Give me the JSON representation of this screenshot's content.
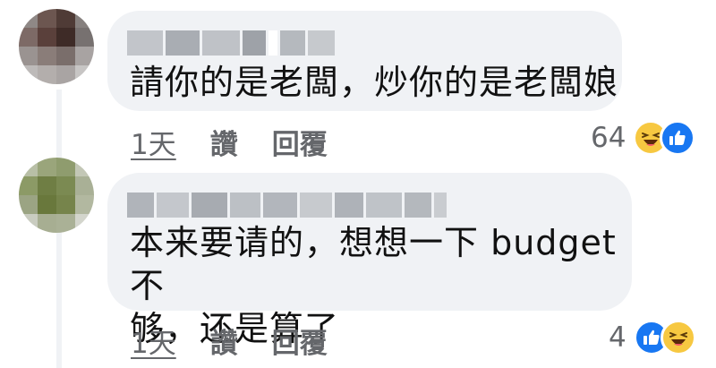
{
  "comments": [
    {
      "author_name": "",
      "text": "請你的是老闆，炒你的是老闆娘",
      "time": "1天",
      "like_label": "讚",
      "reply_label": "回覆",
      "reaction_count": "64",
      "reactions": [
        "haha-icon",
        "like-icon"
      ],
      "avatar_colors": [
        "#8f8886",
        "#6c5650",
        "#4f3b36",
        "#86807e",
        "#7d6a66",
        "#5a403b",
        "#3e2b27",
        "#777170",
        "#9a9391",
        "#8a7d79",
        "#7a6e6b",
        "#a8a3a2",
        "#bdbab9",
        "#b3aeac",
        "#a9a4a3",
        "#c7c5c4"
      ]
    },
    {
      "author_name": "",
      "text": "本来要请的，想想一下 budget 不\n够，还是算了",
      "time": "1天",
      "like_label": "讚",
      "reply_label": "回覆",
      "reaction_count": "4",
      "reactions": [
        "like-icon",
        "haha-icon"
      ],
      "avatar_colors": [
        "#b8bfa6",
        "#9aa57b",
        "#8f9c6e",
        "#c3c7b6",
        "#8c9a66",
        "#6f7e44",
        "#7b8a52",
        "#a9b096",
        "#9ba483",
        "#69783c",
        "#76844b",
        "#b2b8a0",
        "#c9ccc0",
        "#a7ae92",
        "#aab196",
        "#d3d5cc"
      ]
    }
  ]
}
